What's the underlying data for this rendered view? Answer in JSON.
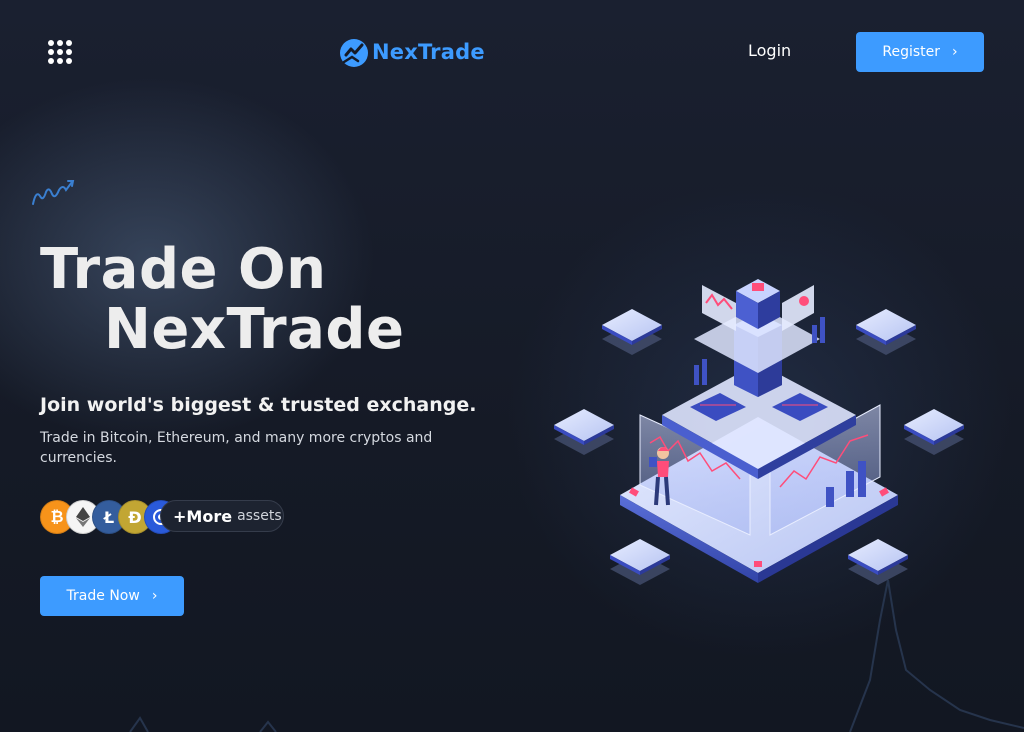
{
  "header": {
    "menu_icon": "grid-menu-icon",
    "logo_text": "NexTrade",
    "login_label": "Login",
    "register_label": "Register"
  },
  "hero": {
    "title_line1": "Trade On",
    "title_line2": "NexTrade",
    "subtitle": "Join world's biggest & trusted exchange.",
    "description": "Trade in Bitcoin, Ethereum, and many more cryptos and currencies.",
    "coins": [
      "bitcoin-icon",
      "ethereum-icon",
      "litecoin-icon",
      "dogecoin-icon",
      "crypto-coin-icon"
    ],
    "more_strong": "+More",
    "more_light": "assets",
    "cta_label": "Trade Now"
  },
  "colors": {
    "accent": "#3d9bff",
    "background": "#161b27"
  }
}
